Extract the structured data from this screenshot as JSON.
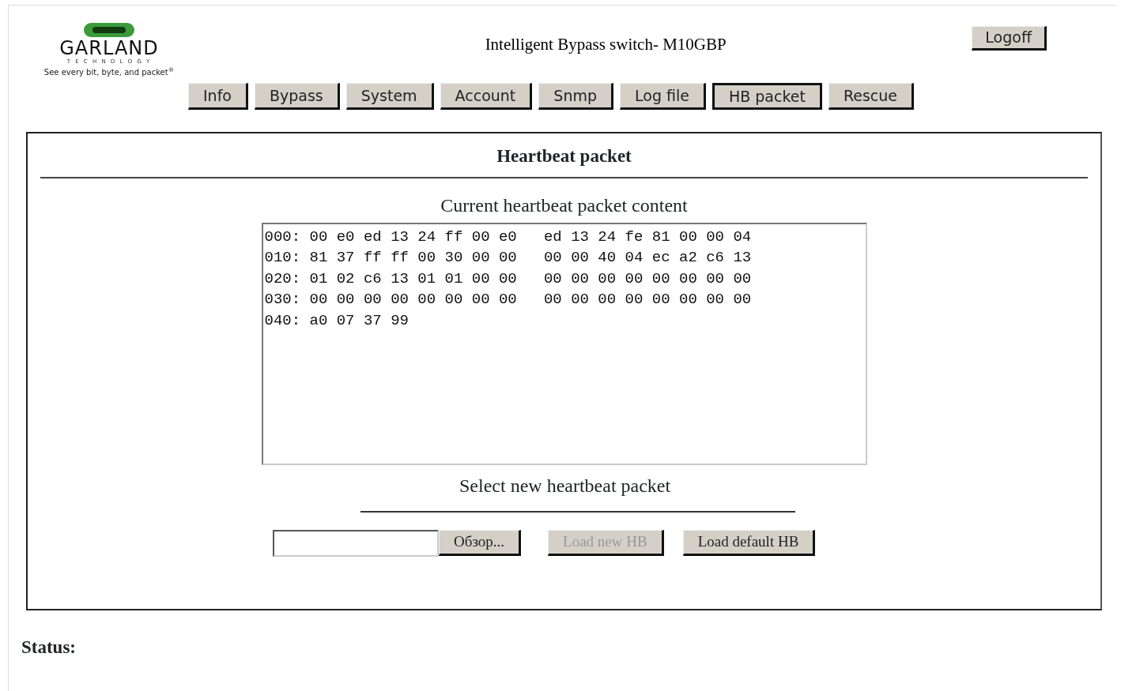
{
  "logo": {
    "name": "GARLAND",
    "subtitle": "T E C H N O L O G Y",
    "tagline": "See every bit, byte, and packet$^{®}$"
  },
  "header": {
    "title": "Intelligent Bypass switch- M10GBP",
    "logoff": "Logoff"
  },
  "tabs": [
    {
      "label": "Info",
      "selected": false
    },
    {
      "label": "Bypass",
      "selected": false
    },
    {
      "label": "System",
      "selected": false
    },
    {
      "label": "Account",
      "selected": false
    },
    {
      "label": "Snmp",
      "selected": false
    },
    {
      "label": "Log file",
      "selected": false
    },
    {
      "label": "HB packet",
      "selected": true
    },
    {
      "label": "Rescue",
      "selected": false
    }
  ],
  "panel": {
    "title": "Heartbeat packet",
    "content_label": "Current heartbeat packet content",
    "content_lines": [
      "000: 00 e0 ed 13 24 ff 00 e0   ed 13 24 fe 81 00 00 04",
      "010: 81 37 ff ff 00 30 00 00   00 00 40 04 ec a2 c6 13",
      "020: 01 02 c6 13 01 01 00 00   00 00 00 00 00 00 00 00",
      "030: 00 00 00 00 00 00 00 00   00 00 00 00 00 00 00 00",
      "040: a0 07 37 99"
    ],
    "select_label": "Select new heartbeat packet",
    "browse_button": "Обзор...",
    "buttons": [
      {
        "label": "Load new HB",
        "disabled": true
      },
      {
        "label": "Load default HB",
        "disabled": false
      }
    ]
  },
  "status": {
    "label": "Status:"
  }
}
